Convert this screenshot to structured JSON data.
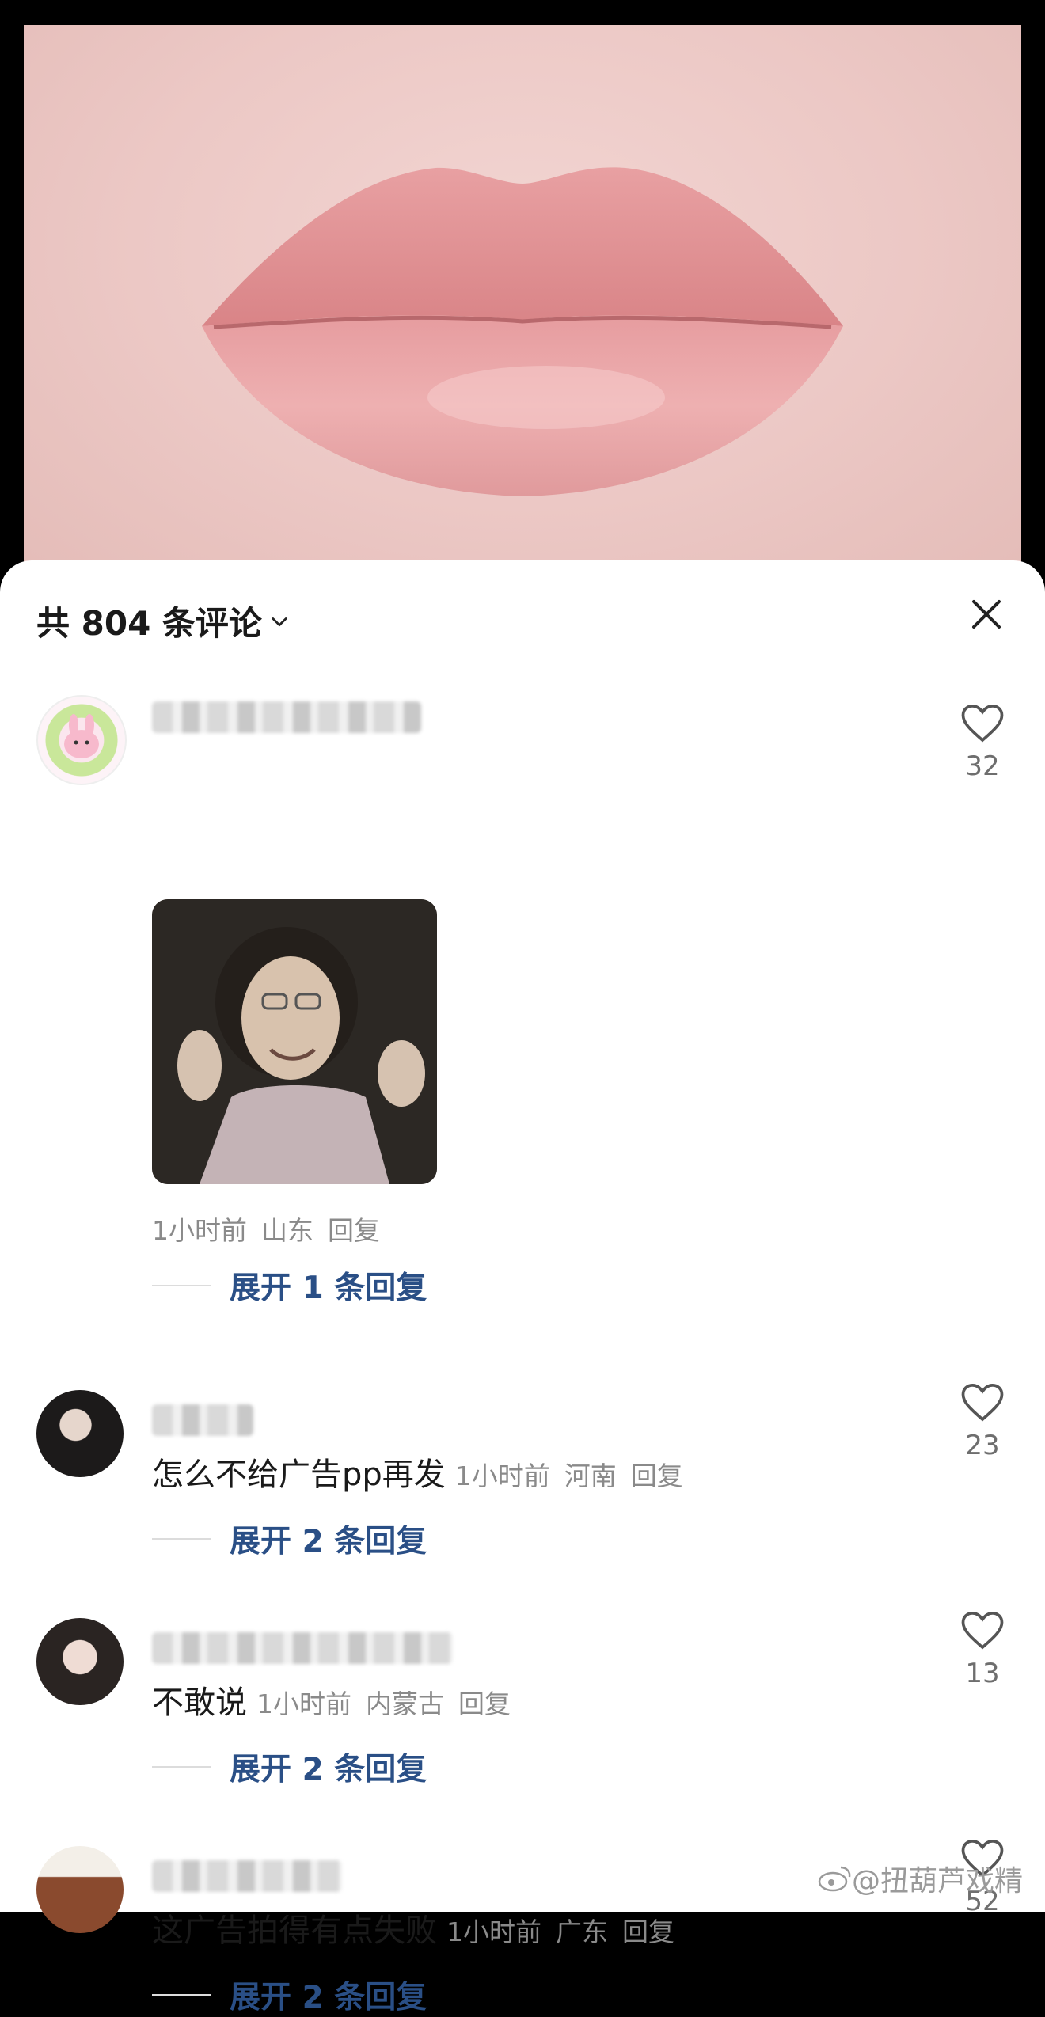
{
  "header": {
    "title": "共 804 条评论"
  },
  "comments": [
    {
      "meta": [
        "1小时前",
        "山东",
        "回复"
      ],
      "expand": "展开 1 条回复",
      "likes": "32"
    },
    {
      "text": "怎么不给广告pp再发",
      "meta": [
        "1小时前",
        "河南",
        "回复"
      ],
      "expand": "展开 2 条回复",
      "likes": "23"
    },
    {
      "text": "不敢说",
      "meta": [
        "1小时前",
        "内蒙古",
        "回复"
      ],
      "expand": "展开 2 条回复",
      "likes": "13"
    },
    {
      "text": "这广告拍得有点失败",
      "meta": [
        "1小时前",
        "广东",
        "回复"
      ],
      "expand": "展开 2 条回复",
      "likes": "52"
    }
  ],
  "watermark": "@扭葫芦戏精",
  "colors": {
    "link": "#2a4f86",
    "meta": "#8a8a8a",
    "sheet": "#ffffff"
  },
  "icons": [
    "chevron-down-icon",
    "close-icon",
    "heart-icon",
    "weibo-icon"
  ]
}
